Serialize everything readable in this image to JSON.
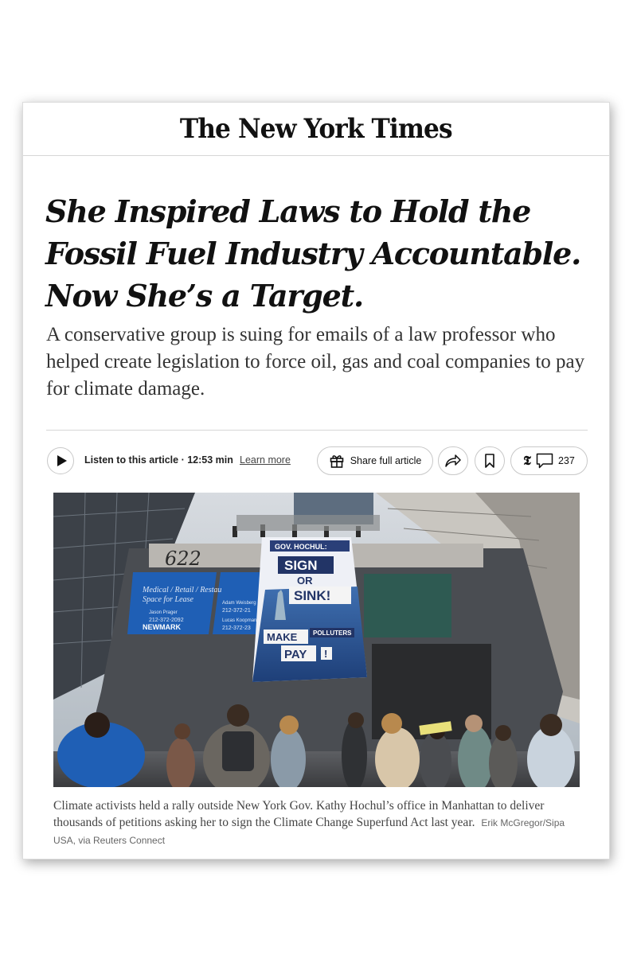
{
  "masthead": {
    "title": "The New York Times"
  },
  "article": {
    "headline": "She Inspired Laws to Hold the Fossil Fuel Industry Accountable. Now She’s a Target.",
    "dek": "A conservative group is suing for emails of a law professor who helped create legislation to force oil, gas and coal companies to pay for climate damage."
  },
  "toolbar": {
    "listen_label": "Listen to this article",
    "listen_duration": " · 12:53 min",
    "learn_more": "Learn more",
    "share_full_label": "Share full article",
    "comment_count": "237"
  },
  "photo": {
    "building_number": "622",
    "sign_lines": [
      "Medical / Retail / Restau",
      "Space for Lease",
      "Jason Prager",
      "212-372-2092",
      "Adam Weisberg",
      "212-372-21",
      "Lucas Koopman",
      "212-372-23"
    ],
    "sign_brand": "NEWMARK",
    "banner": {
      "top": "GOV. HOCHUL:",
      "line1": "SIGN",
      "line2": "OR",
      "line3": "SINK!",
      "bottom1": "MAKE",
      "bottom2": "POLLUTERS",
      "bottom3": "PAY",
      "bottom4": "!"
    }
  },
  "caption": {
    "text": "Climate activists held a rally outside New York Gov. Kathy Hochul’s office in Manhattan to deliver thousands of petitions asking her to sign the Climate Change Superfund Act last year.",
    "credit": "Erik McGregor/Sipa USA, via Reuters Connect"
  }
}
